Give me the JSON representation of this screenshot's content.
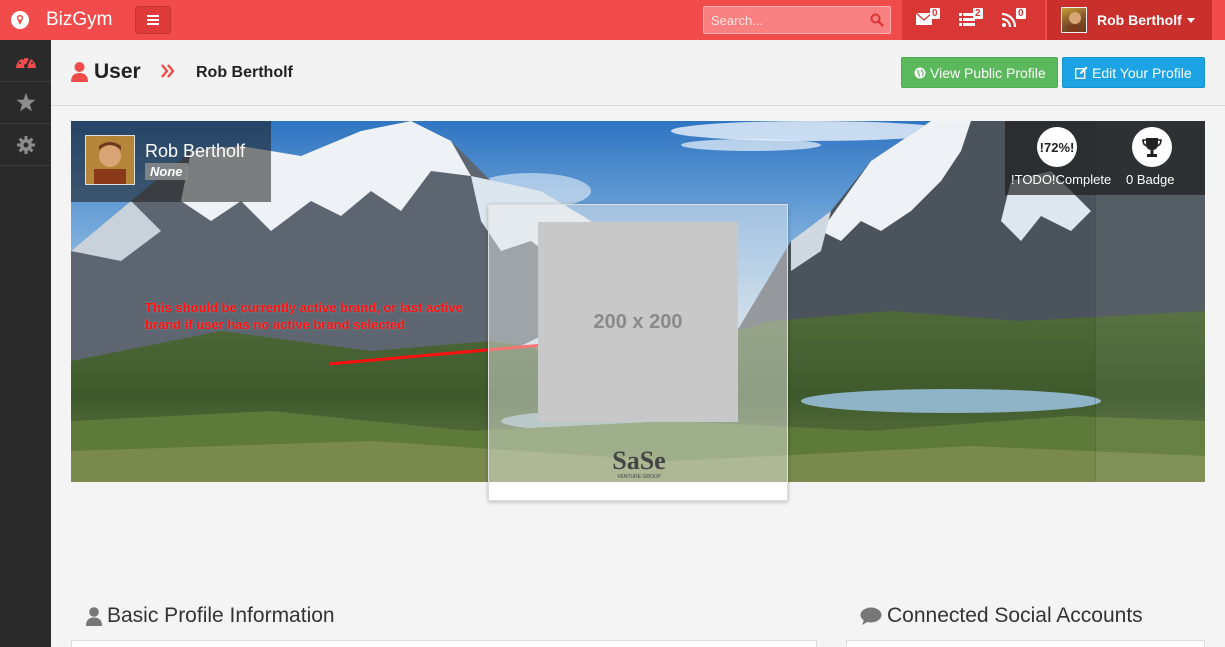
{
  "topbar": {
    "brand": "BizGym",
    "search_placeholder": "Search...",
    "notifications": [
      {
        "icon": "envelope-icon",
        "count": "0"
      },
      {
        "icon": "tasks-icon",
        "count": "2"
      },
      {
        "icon": "rss-icon",
        "count": "0"
      }
    ],
    "user_name": "Rob Bertholf"
  },
  "sidebar": {
    "items": [
      {
        "icon": "dashboard-icon",
        "active": true
      },
      {
        "icon": "star-icon",
        "active": false
      },
      {
        "icon": "gear-icon",
        "active": false
      }
    ]
  },
  "header": {
    "title": "User",
    "breadcrumb": "Rob Bertholf",
    "view_public_profile": "View Public Profile",
    "edit_profile": "Edit Your Profile"
  },
  "profile": {
    "name": "Rob Bertholf",
    "brand": "None",
    "completion": "!72%!",
    "completion_label": "!TODO!Complete",
    "badge_label": "0 Badge",
    "annotation": "This should be currently active brand, or last active brand if user has no active brand selected",
    "placeholder": "200 x 200",
    "logo_text": "SaSe",
    "logo_subtext": "VENTURE GROUP"
  },
  "sections": {
    "basic_info": "Basic Profile Information",
    "social": "Connected Social Accounts"
  },
  "colors": {
    "topbar": "#f24b4b",
    "topbar_dark": "#c9302c",
    "sidebar": "#2a2a2a",
    "green": "#5cb85c",
    "blue": "#1ba3e3"
  }
}
